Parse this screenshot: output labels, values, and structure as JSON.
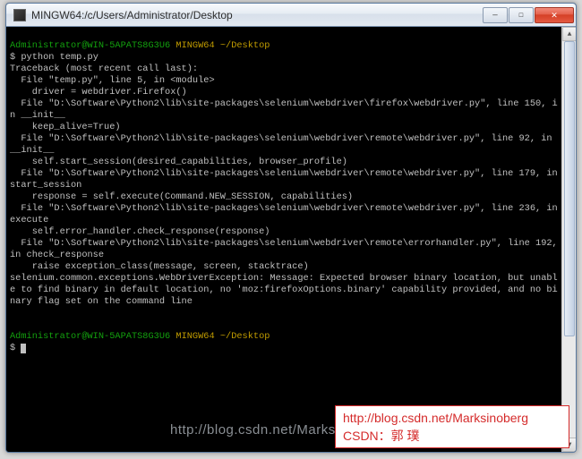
{
  "window": {
    "title": "MINGW64:/c/Users/Administrator/Desktop"
  },
  "prompt": {
    "user_host": "Administrator@WIN-5APATS8G3U6",
    "env": "MINGW64",
    "path": "~/Desktop",
    "command": "python temp.py",
    "prompt_char": "$"
  },
  "traceback": {
    "header": "Traceback (most recent call last):",
    "frames": [
      {
        "file": "  File \"temp.py\", line 5, in <module>",
        "code": "    driver = webdriver.Firefox()"
      },
      {
        "file": "  File \"D:\\Software\\Python2\\lib\\site-packages\\selenium\\webdriver\\firefox\\webdriver.py\", line 150, in __init__",
        "code": "    keep_alive=True)"
      },
      {
        "file": "  File \"D:\\Software\\Python2\\lib\\site-packages\\selenium\\webdriver\\remote\\webdriver.py\", line 92, in __init__",
        "code": "    self.start_session(desired_capabilities, browser_profile)"
      },
      {
        "file": "  File \"D:\\Software\\Python2\\lib\\site-packages\\selenium\\webdriver\\remote\\webdriver.py\", line 179, in start_session",
        "code": "    response = self.execute(Command.NEW_SESSION, capabilities)"
      },
      {
        "file": "  File \"D:\\Software\\Python2\\lib\\site-packages\\selenium\\webdriver\\remote\\webdriver.py\", line 236, in execute",
        "code": "    self.error_handler.check_response(response)"
      },
      {
        "file": "  File \"D:\\Software\\Python2\\lib\\site-packages\\selenium\\webdriver\\remote\\errorhandler.py\", line 192, in check_response",
        "code": "    raise exception_class(message, screen, stacktrace)"
      }
    ],
    "exception": "selenium.common.exceptions.WebDriverException: Message: Expected browser binary location, but unable to find binary in default location, no 'moz:firefoxOptions.binary' capability provided, and no binary flag set on the command line"
  },
  "watermarks": {
    "faint": "http://blog.csdn.net/Marksinoberg",
    "box_line1": "http://blog.csdn.net/Marksinoberg",
    "box_line2": "CSDN：郭 璞"
  },
  "glyphs": {
    "min": "—",
    "max": "☐",
    "close": "✕",
    "up": "▲",
    "down": "▼"
  }
}
